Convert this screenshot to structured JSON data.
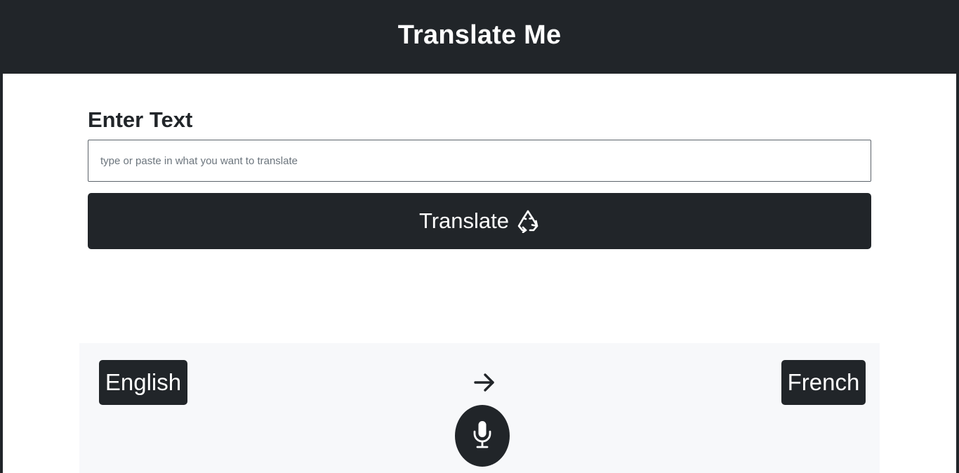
{
  "header": {
    "title": "Translate Me"
  },
  "form": {
    "label": "Enter Text",
    "input_value": "",
    "input_placeholder": "type or paste in what you want to translate",
    "translate_label": "Translate",
    "translate_icon": "recycle-icon"
  },
  "languages": {
    "source": "English",
    "target": "French",
    "arrow_icon": "arrow-right-icon",
    "mic_icon": "microphone-icon"
  },
  "colors": {
    "dark": "#212529",
    "panel": "#f7f8fa",
    "white": "#ffffff"
  }
}
